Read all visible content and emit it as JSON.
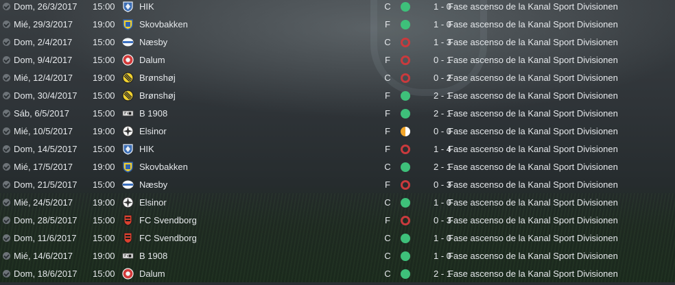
{
  "matches": [
    {
      "date": "Dom, 26/3/2017",
      "time": "15:00",
      "team": "HIK",
      "badge": "hik-badge-icon",
      "venue": "C",
      "result": "W",
      "score": "1 - 0",
      "competition": "Fase ascenso de la Kanal Sport Divisionen"
    },
    {
      "date": "Mié, 29/3/2017",
      "time": "19:00",
      "team": "Skovbakken",
      "badge": "skovbakken-badge-icon",
      "venue": "F",
      "result": "W",
      "score": "1 - 0",
      "competition": "Fase ascenso de la Kanal Sport Divisionen"
    },
    {
      "date": "Dom, 2/4/2017",
      "time": "15:00",
      "team": "Næsby",
      "badge": "naesby-badge-icon",
      "venue": "C",
      "result": "L",
      "score": "1 - 3",
      "competition": "Fase ascenso de la Kanal Sport Divisionen"
    },
    {
      "date": "Dom, 9/4/2017",
      "time": "15:00",
      "team": "Dalum",
      "badge": "dalum-badge-icon",
      "venue": "F",
      "result": "L",
      "score": "0 - 1",
      "competition": "Fase ascenso de la Kanal Sport Divisionen"
    },
    {
      "date": "Mié, 12/4/2017",
      "time": "19:00",
      "team": "Brønshøj",
      "badge": "bronshoj-badge-icon",
      "venue": "C",
      "result": "L",
      "score": "0 - 2",
      "competition": "Fase ascenso de la Kanal Sport Divisionen"
    },
    {
      "date": "Dom, 30/4/2017",
      "time": "15:00",
      "team": "Brønshøj",
      "badge": "bronshoj-badge-icon",
      "venue": "F",
      "result": "W",
      "score": "2 - 1",
      "competition": "Fase ascenso de la Kanal Sport Divisionen"
    },
    {
      "date": "Sáb, 6/5/2017",
      "time": "15:00",
      "team": "B 1908",
      "badge": "b1908-badge-icon",
      "venue": "F",
      "result": "W",
      "score": "2 - 1",
      "competition": "Fase ascenso de la Kanal Sport Divisionen"
    },
    {
      "date": "Mié, 10/5/2017",
      "time": "19:00",
      "team": "Elsinor",
      "badge": "elsinor-badge-icon",
      "venue": "F",
      "result": "D",
      "score": "0 - 0",
      "competition": "Fase ascenso de la Kanal Sport Divisionen"
    },
    {
      "date": "Dom, 14/5/2017",
      "time": "15:00",
      "team": "HIK",
      "badge": "hik-badge-icon",
      "venue": "F",
      "result": "L",
      "score": "1 - 4",
      "competition": "Fase ascenso de la Kanal Sport Divisionen"
    },
    {
      "date": "Mié, 17/5/2017",
      "time": "19:00",
      "team": "Skovbakken",
      "badge": "skovbakken-badge-icon",
      "venue": "C",
      "result": "W",
      "score": "2 - 1",
      "competition": "Fase ascenso de la Kanal Sport Divisionen"
    },
    {
      "date": "Dom, 21/5/2017",
      "time": "15:00",
      "team": "Næsby",
      "badge": "naesby-badge-icon",
      "venue": "F",
      "result": "L",
      "score": "0 - 3",
      "competition": "Fase ascenso de la Kanal Sport Divisionen"
    },
    {
      "date": "Mié, 24/5/2017",
      "time": "19:00",
      "team": "Elsinor",
      "badge": "elsinor-badge-icon",
      "venue": "C",
      "result": "W",
      "score": "1 - 0",
      "competition": "Fase ascenso de la Kanal Sport Divisionen"
    },
    {
      "date": "Dom, 28/5/2017",
      "time": "15:00",
      "team": "FC Svendborg",
      "badge": "fc-svendborg-badge-icon",
      "venue": "F",
      "result": "L",
      "score": "0 - 3",
      "competition": "Fase ascenso de la Kanal Sport Divisionen"
    },
    {
      "date": "Dom, 11/6/2017",
      "time": "15:00",
      "team": "FC Svendborg",
      "badge": "fc-svendborg-badge-icon",
      "venue": "C",
      "result": "W",
      "score": "1 - 0",
      "competition": "Fase ascenso de la Kanal Sport Divisionen"
    },
    {
      "date": "Mié, 14/6/2017",
      "time": "19:00",
      "team": "B 1908",
      "badge": "b1908-badge-icon",
      "venue": "C",
      "result": "W",
      "score": "1 - 0",
      "competition": "Fase ascenso de la Kanal Sport Divisionen"
    },
    {
      "date": "Dom, 18/6/2017",
      "time": "15:00",
      "team": "Dalum",
      "badge": "dalum-badge-icon",
      "venue": "C",
      "result": "W",
      "score": "2 - 1",
      "competition": "Fase ascenso de la Kanal Sport Divisionen"
    }
  ],
  "colors": {
    "win": "#3ec07a",
    "loss": "#c93a3d",
    "draw": "#f1a529",
    "text": "#e6e9ec"
  }
}
